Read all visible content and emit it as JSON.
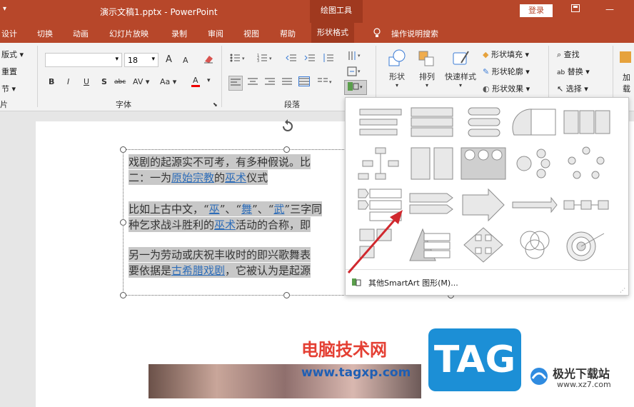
{
  "titlebar": {
    "quick_access": "▾",
    "document_title": "演示文稿1.pptx  -  PowerPoint",
    "contextual_tab": "绘图工具",
    "login": "登录",
    "ribbon_display_icon": "ribbon-display-icon",
    "minimize": "—"
  },
  "tabs": [
    "设计",
    "切换",
    "动画",
    "幻灯片放映",
    "录制",
    "审阅",
    "视图",
    "帮助",
    "形状格式",
    "操作说明搜索"
  ],
  "ribbon": {
    "slides": {
      "layout": "版式",
      "reset": "重置",
      "section": "节",
      "group_label": "片"
    },
    "font": {
      "font_name": "",
      "font_size": "18",
      "group_label": "字体",
      "bold": "B",
      "italic": "I",
      "underline": "U",
      "shadow": "S",
      "strike": "abc",
      "spacing": "AV",
      "case": "Aa",
      "color": "A",
      "grow": "A",
      "shrink": "A"
    },
    "paragraph": {
      "group_label": "段落"
    },
    "drawing": {
      "shapes": "形状",
      "arrange": "排列",
      "quick_styles": "快速样式",
      "shape_fill": "形状填充",
      "shape_outline": "形状轮廓",
      "shape_effects": "形状效果"
    },
    "editing": {
      "find": "查找",
      "replace": "替换",
      "select": "选择",
      "addin_1": "加",
      "addin_2": "载"
    }
  },
  "slide": {
    "lines": [
      {
        "parts": [
          {
            "t": "戏剧的起源实不可考，有多种假说。比",
            "link": false
          }
        ]
      },
      {
        "parts": [
          {
            "t": "二：一为",
            "link": false
          },
          {
            "t": "原始宗教",
            "link": true
          },
          {
            "t": "的",
            "link": false
          },
          {
            "t": "巫术",
            "link": true
          },
          {
            "t": "仪式",
            "link": false
          }
        ]
      },
      {
        "parts": [
          {
            "t": " ",
            "link": false
          }
        ]
      },
      {
        "parts": [
          {
            "t": "比如上古中文，“",
            "link": false
          },
          {
            "t": "巫",
            "link": true
          },
          {
            "t": "”、“",
            "link": false
          },
          {
            "t": "舞",
            "link": true
          },
          {
            "t": "”、“",
            "link": false
          },
          {
            "t": "武",
            "link": true
          },
          {
            "t": "”三字同",
            "link": false
          }
        ]
      },
      {
        "parts": [
          {
            "t": "种乞求战斗胜利的",
            "link": false
          },
          {
            "t": "巫术",
            "link": true
          },
          {
            "t": "活动的合称，即",
            "link": false
          }
        ]
      },
      {
        "parts": [
          {
            "t": " ",
            "link": false
          }
        ]
      },
      {
        "parts": [
          {
            "t": "另一为劳动或庆祝丰收时的即兴歌舞表",
            "link": false
          }
        ]
      },
      {
        "parts": [
          {
            "t": "要依据是",
            "link": false
          },
          {
            "t": "古希腊戏剧",
            "link": true
          },
          {
            "t": "，它被认为是起源",
            "link": false
          }
        ]
      }
    ]
  },
  "gallery": {
    "more_label": "其他SmartArt 图形(M)...",
    "items": [
      "list",
      "vertical-list",
      "stacked-list",
      "circle-list",
      "table-list",
      "hierarchy",
      "picture-list",
      "circles-process",
      "cluster",
      "cycle",
      "chevron-list",
      "process-arrows",
      "arrow-process",
      "arrow-timeline",
      "step-process",
      "picture-caption",
      "pyramid",
      "diamond-matrix",
      "venn",
      "target"
    ]
  },
  "watermark": {
    "title": "电脑技术网",
    "url": "www.tagxp.com",
    "tag": "TAG",
    "site_name": "极光下载站",
    "site_url": "www.xz7.com"
  },
  "colors": {
    "accent": "#b7472a",
    "link": "#2e6db8",
    "highlight": "#c8c8c8",
    "arrow": "#d0282e"
  }
}
